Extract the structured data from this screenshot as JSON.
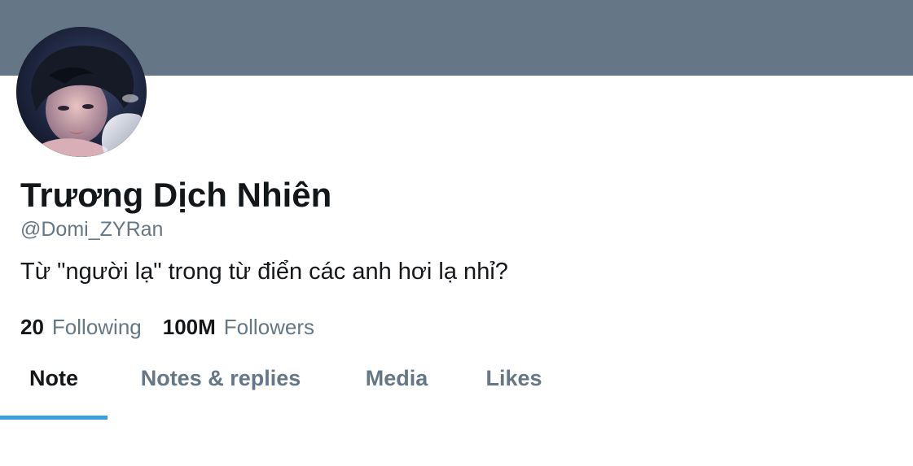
{
  "profile": {
    "display_name": "Trương Dịch Nhiên",
    "handle": "@Domi_ZYRan",
    "bio": "Từ \"người lạ\" trong từ điển các anh hơi lạ nhỉ?",
    "avatar": {
      "type": "photo",
      "description_icon": "profile-photo"
    }
  },
  "stats": {
    "following": {
      "count": "20",
      "label": "Following"
    },
    "followers": {
      "count": "100M",
      "label": "Followers"
    }
  },
  "tabs": [
    {
      "label": "Note",
      "active": true
    },
    {
      "label": "Notes & replies",
      "active": false
    },
    {
      "label": "Media",
      "active": false
    },
    {
      "label": "Likes",
      "active": false
    }
  ],
  "colors": {
    "banner": "#657786",
    "primary_text": "#14171a",
    "secondary_text": "#657786",
    "tab_indicator": "#3a9fde",
    "background": "#ffffff"
  }
}
